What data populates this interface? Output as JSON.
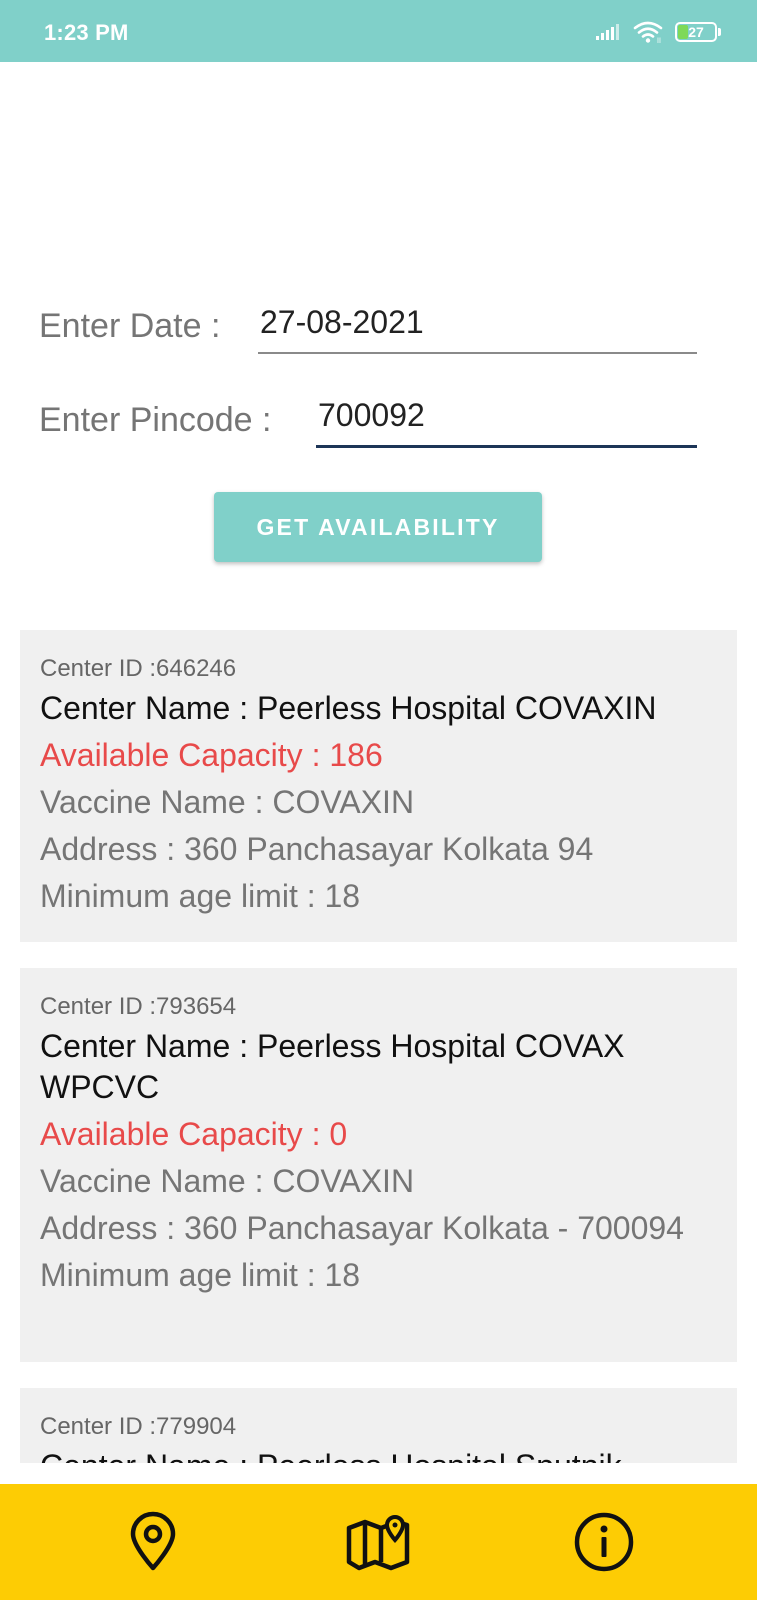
{
  "status_bar": {
    "time": "1:23 PM",
    "battery_level": "27",
    "icons": [
      "signal-icon",
      "wifi-icon",
      "battery-icon"
    ]
  },
  "form": {
    "date_label": "Enter Date :",
    "date_value": "27-08-2021",
    "pincode_label": "Enter Pincode :",
    "pincode_value": "700092",
    "button_label": "GET AVAILABILITY"
  },
  "centers": [
    {
      "center_id": "Center ID :646246",
      "name": "Center Name : Peerless Hospital COVAXIN",
      "capacity": "Available Capacity : 186",
      "vaccine": "Vaccine Name : COVAXIN",
      "address": "Address : 360 Panchasayar Kolkata 94",
      "min_age": "Minimum age limit : 18"
    },
    {
      "center_id": "Center ID :793654",
      "name": "Center Name : Peerless Hospital COVAX WPCVC",
      "capacity": "Available Capacity : 0",
      "vaccine": "Vaccine Name : COVAXIN",
      "address": "Address : 360 Panchasayar Kolkata - 700094",
      "min_age": "Minimum age limit : 18"
    },
    {
      "center_id": "Center ID :779904",
      "name": "Center Name : Peerless Hospital Sputnik"
    }
  ],
  "bottom_nav": {
    "items": [
      "location-pin-icon",
      "map-icon",
      "info-icon"
    ]
  },
  "colors": {
    "primary": "#80d0c9",
    "accent_nav": "#fdcc04",
    "capacity_text": "#e84a4a",
    "card_bg": "#f0f0f0",
    "input_focus_line": "#1d3557"
  }
}
